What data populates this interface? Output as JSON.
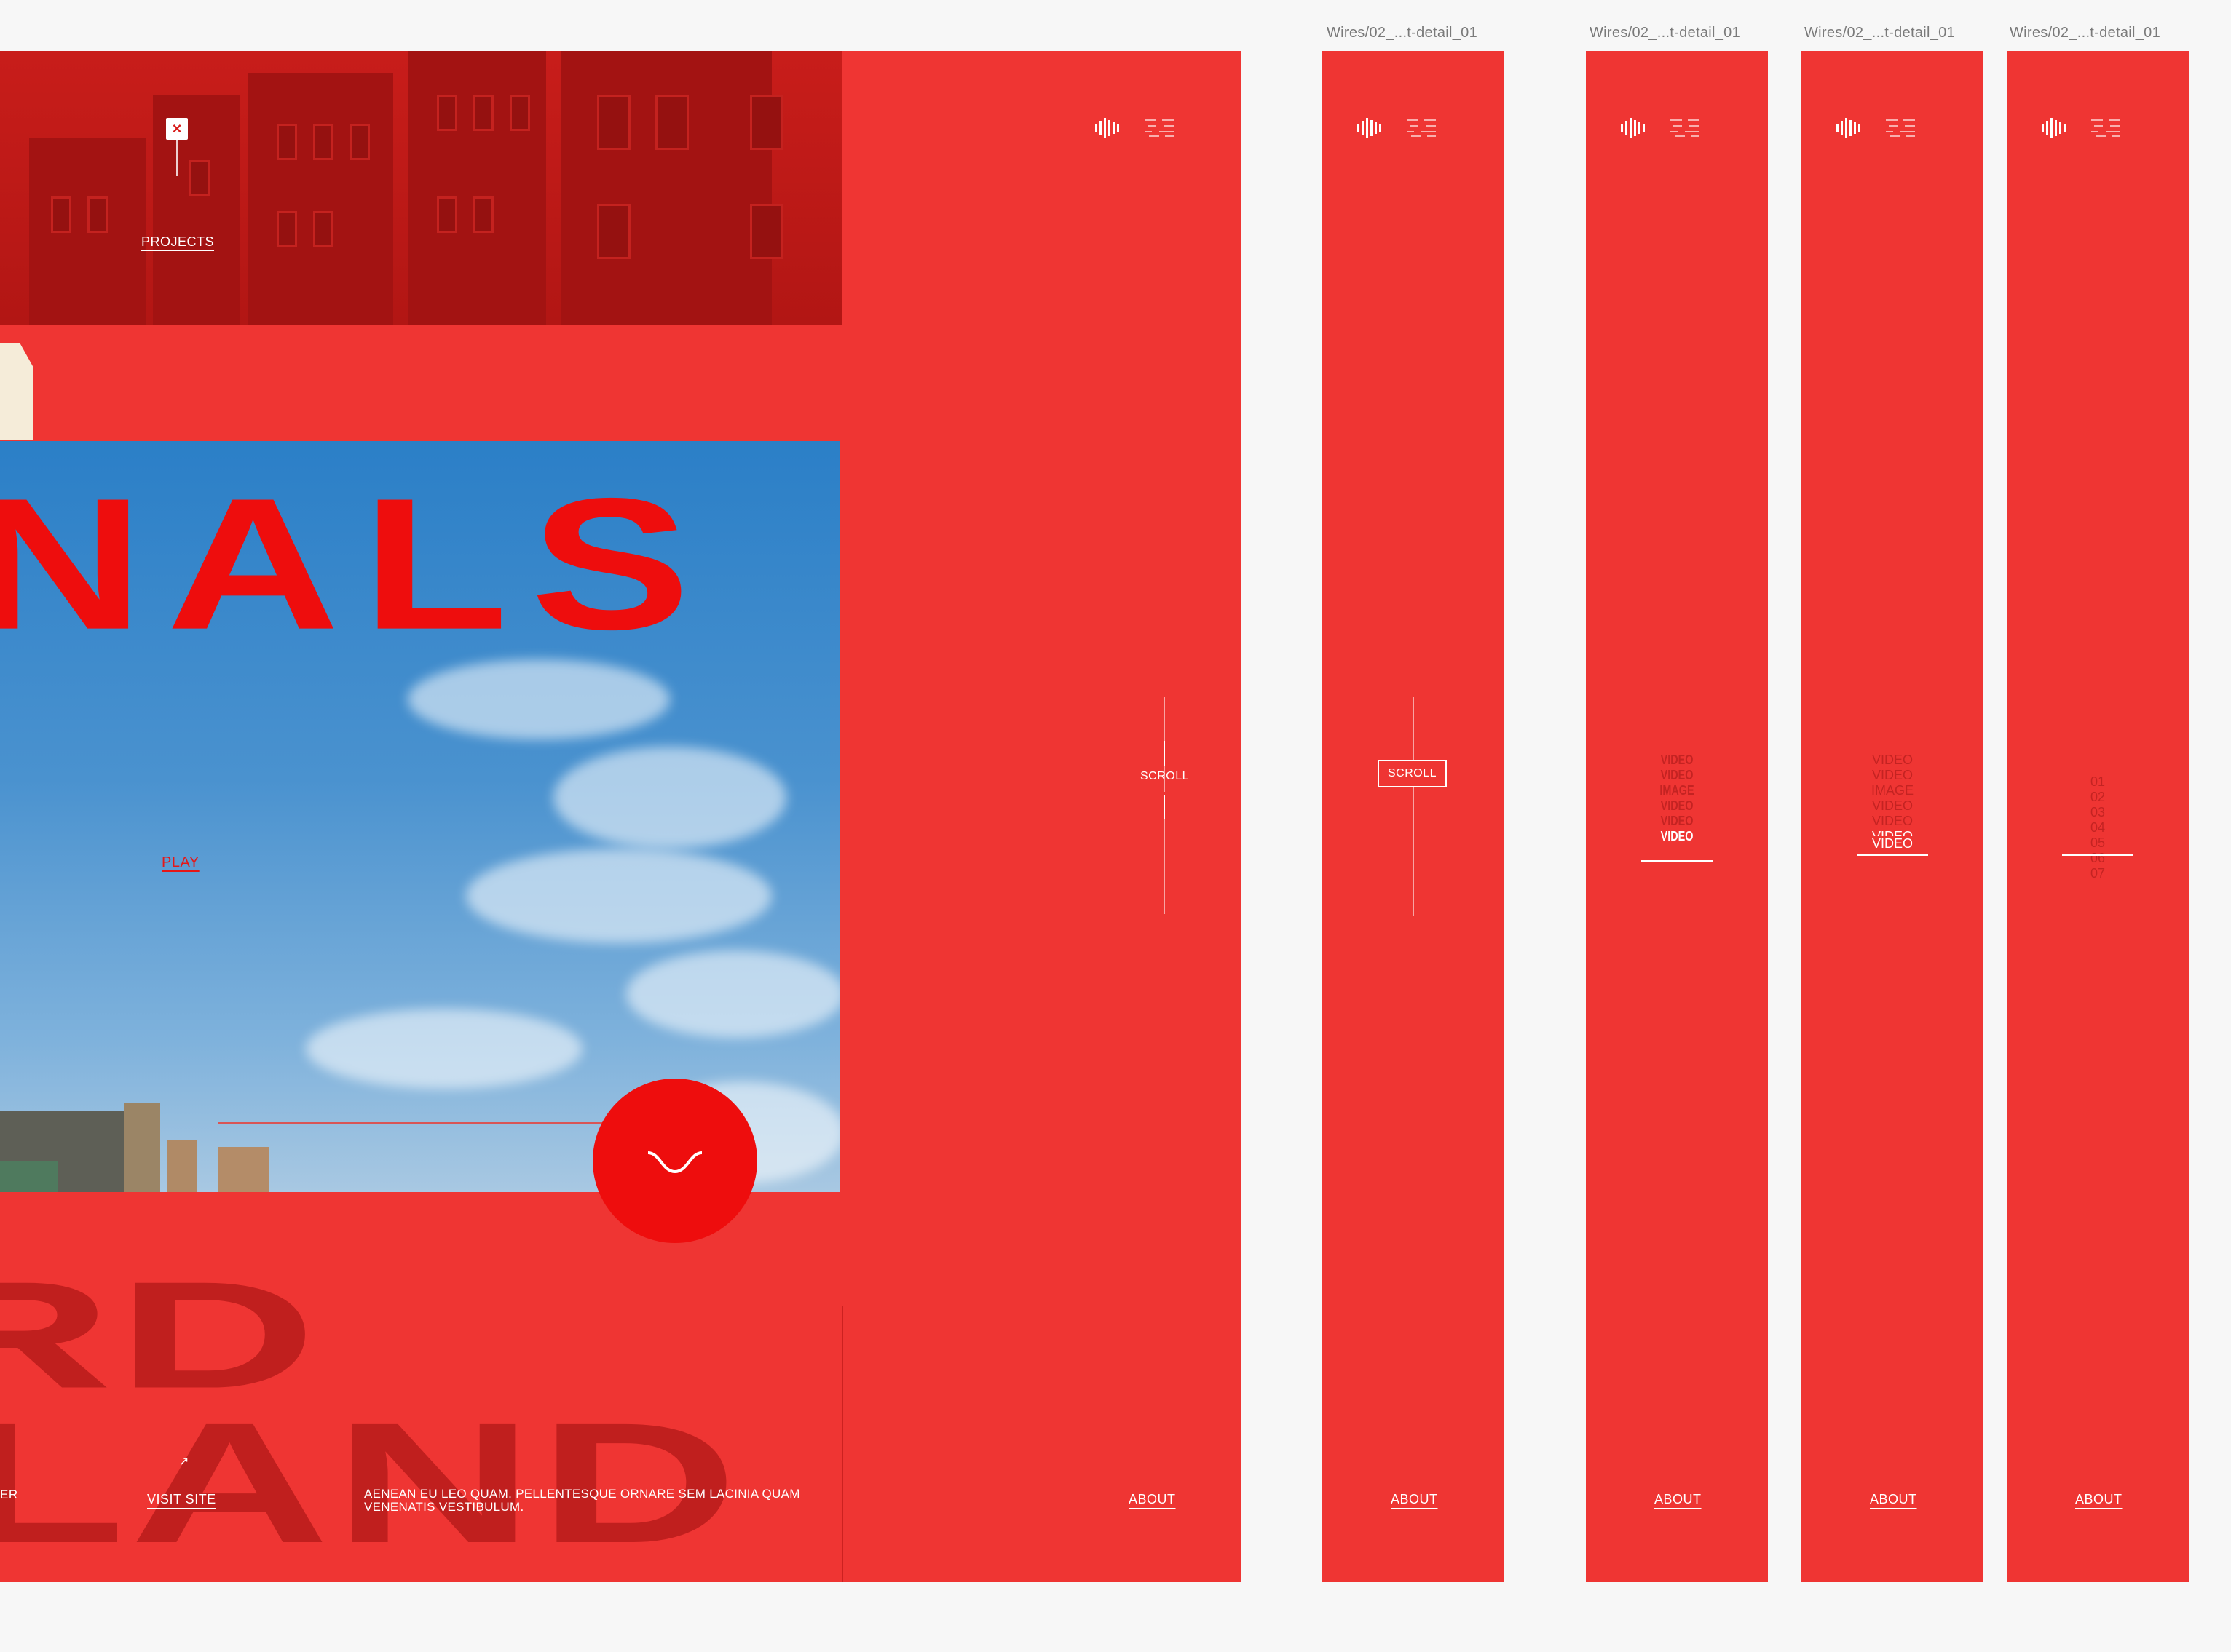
{
  "main": {
    "nav_projects": "PROJECTS",
    "close_glyph": "×",
    "hero_word": "NALS",
    "play": "PLAY",
    "scroll": "SCROLL",
    "bottom_word_top": "RD",
    "bottom_word_bottom": "LAND",
    "left_edge_text": "ER",
    "visit_site": "VISIT SITE",
    "arrow_glyph": "↗",
    "description": "AENEAN EU LEO QUAM. PELLENTESQUE ORNARE SEM LACINIA QUAM VENENATIS VESTIBULUM.",
    "about": "ABOUT"
  },
  "frames": [
    {
      "label": "Wires/02_...t-detail_01",
      "scroll": "SCROLL",
      "about": "ABOUT"
    },
    {
      "label": "Wires/02_...t-detail_01",
      "stack": [
        "VIDEO",
        "VIDEO",
        "IMAGE",
        "VIDEO",
        "VIDEO",
        "VIDEO"
      ],
      "about": "ABOUT"
    },
    {
      "label": "Wires/02_...t-detail_01",
      "stack": [
        "VIDEO",
        "VIDEO",
        "IMAGE",
        "VIDEO",
        "VIDEO",
        "VIDEO",
        "VIDEO"
      ],
      "about": "ABOUT"
    },
    {
      "label": "Wires/02_...t-detail_01",
      "stack": [
        "01",
        "02",
        "03",
        "04",
        "05",
        "06",
        "07"
      ],
      "about": "ABOUT"
    }
  ],
  "icons": {
    "sound": "sound-bars-icon",
    "grid": "dotted-grid-icon"
  },
  "colors": {
    "artboard": "#ef3533",
    "hero_red": "#ee0d0d",
    "canvas": "#f7f7f7",
    "sky": "#2b7fc7"
  }
}
